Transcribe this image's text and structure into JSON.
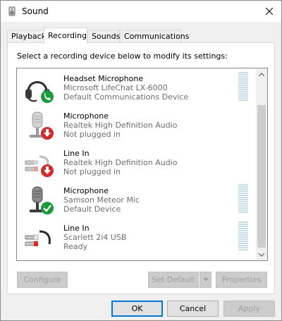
{
  "window": {
    "title": "Sound"
  },
  "tabs": [
    {
      "label": "Playback"
    },
    {
      "label": "Recording"
    },
    {
      "label": "Sounds"
    },
    {
      "label": "Communications"
    }
  ],
  "instruction": "Select a recording device below to modify its settings:",
  "devices": [
    {
      "name": "Headset Microphone",
      "desc": "Microsoft LifeChat LX-6000",
      "status": "Default Communications Device",
      "icon": "headset-icon",
      "badge": "phone-badge-icon",
      "meter": true
    },
    {
      "name": "Microphone",
      "desc": "Realtek High Definition Audio",
      "status": "Not plugged in",
      "icon": "microphone-icon",
      "badge": "down-arrow-badge-icon",
      "meter": false
    },
    {
      "name": "Line In",
      "desc": "Realtek High Definition Audio",
      "status": "Not plugged in",
      "icon": "line-in-cable-icon",
      "badge": "down-arrow-badge-icon",
      "meter": false
    },
    {
      "name": "Microphone",
      "desc": "Samson Meteor Mic",
      "status": "Default Device",
      "icon": "microphone-icon",
      "badge": "checkmark-badge-icon",
      "meter": true
    },
    {
      "name": "Line In",
      "desc": "Scarlett 2i4 USB",
      "status": "Ready",
      "icon": "line-in-cable-icon",
      "badge": "",
      "meter": true
    }
  ],
  "buttons": {
    "configure": "Configure",
    "set_default": "Set Default",
    "properties": "Properties",
    "ok": "OK",
    "cancel": "Cancel",
    "apply": "Apply"
  },
  "colors": {
    "accent": "#0078d7",
    "badge_green": "#1c9a3e",
    "badge_red": "#d12b2b",
    "meter": "#c8dde6"
  }
}
